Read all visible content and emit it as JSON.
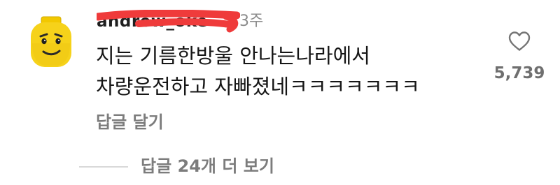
{
  "comment": {
    "avatar_icon": "lego-head-avatar",
    "username": "andrew_oke",
    "time": "3주",
    "text_lines": [
      "지는 기름한방울 안나는나라에서",
      "차량운전하고 자빠졌네ㅋㅋㅋㅋㅋㅋㅋ"
    ],
    "reply_label": "답글 달기",
    "like_icon": "heart-outline-icon",
    "like_count": "5,739"
  },
  "more_replies": {
    "label": "답글 24개 더 보기"
  },
  "colors": {
    "redaction": "#ef3b3b",
    "avatar_yellow": "#f6d21a",
    "secondary_text": "#7c7c7c"
  }
}
